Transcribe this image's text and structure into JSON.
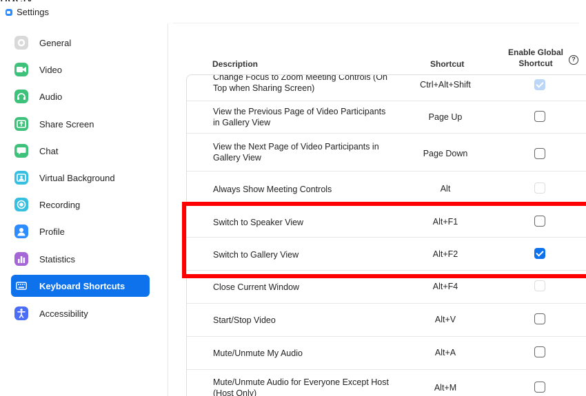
{
  "window": {
    "clipped_top_text": "ngely",
    "title": "Settings"
  },
  "colors": {
    "accent": "#0e72ed",
    "highlight": "#ff0000"
  },
  "sidebar": {
    "items": [
      {
        "label": "General",
        "icon": "gear-icon",
        "color": "#d9d9d9"
      },
      {
        "label": "Video",
        "icon": "video-icon",
        "color": "#3ec17a"
      },
      {
        "label": "Audio",
        "icon": "headphones-icon",
        "color": "#3ec17a"
      },
      {
        "label": "Share Screen",
        "icon": "share-screen-icon",
        "color": "#3ec17a"
      },
      {
        "label": "Chat",
        "icon": "chat-icon",
        "color": "#3ec17a"
      },
      {
        "label": "Virtual Background",
        "icon": "virtual-background-icon",
        "color": "#36bfe0"
      },
      {
        "label": "Recording",
        "icon": "record-icon",
        "color": "#36bfe0"
      },
      {
        "label": "Profile",
        "icon": "profile-icon",
        "color": "#2d8cff"
      },
      {
        "label": "Statistics",
        "icon": "statistics-icon",
        "color": "#a566d8"
      },
      {
        "label": "Keyboard Shortcuts",
        "icon": "keyboard-icon",
        "color": "#0e72ed",
        "active": true
      },
      {
        "label": "Accessibility",
        "icon": "accessibility-icon",
        "color": "#4c6ef5"
      }
    ]
  },
  "table": {
    "headers": {
      "description": "Description",
      "shortcut": "Shortcut",
      "global_line1": "Enable Global",
      "global_line2": "Shortcut"
    },
    "rows": [
      {
        "desc": "Change Focus to Zoom Meeting Controls (On Top when Sharing Screen)",
        "shortcut": "Ctrl+Alt+Shift",
        "global": "disabled-checked"
      },
      {
        "desc": "View the Previous Page of Video Participants in Gallery View",
        "shortcut": "Page Up",
        "global": "unchecked"
      },
      {
        "desc": "View the Next Page of Video Participants in Gallery View",
        "shortcut": "Page Down",
        "global": "unchecked"
      },
      {
        "desc": "Always Show Meeting Controls",
        "shortcut": "Alt",
        "global": "disabled"
      },
      {
        "desc": "Switch to Speaker View",
        "shortcut": "Alt+F1",
        "global": "unchecked"
      },
      {
        "desc": "Switch to Gallery View",
        "shortcut": "Alt+F2",
        "global": "checked"
      },
      {
        "desc": "Close Current Window",
        "shortcut": "Alt+F4",
        "global": "disabled"
      },
      {
        "desc": "Start/Stop Video",
        "shortcut": "Alt+V",
        "global": "unchecked"
      },
      {
        "desc": "Mute/Unmute My Audio",
        "shortcut": "Alt+A",
        "global": "unchecked"
      },
      {
        "desc": "Mute/Unmute Audio for Everyone Except Host (Host Only)",
        "shortcut": "Alt+M",
        "global": "unchecked"
      }
    ]
  }
}
